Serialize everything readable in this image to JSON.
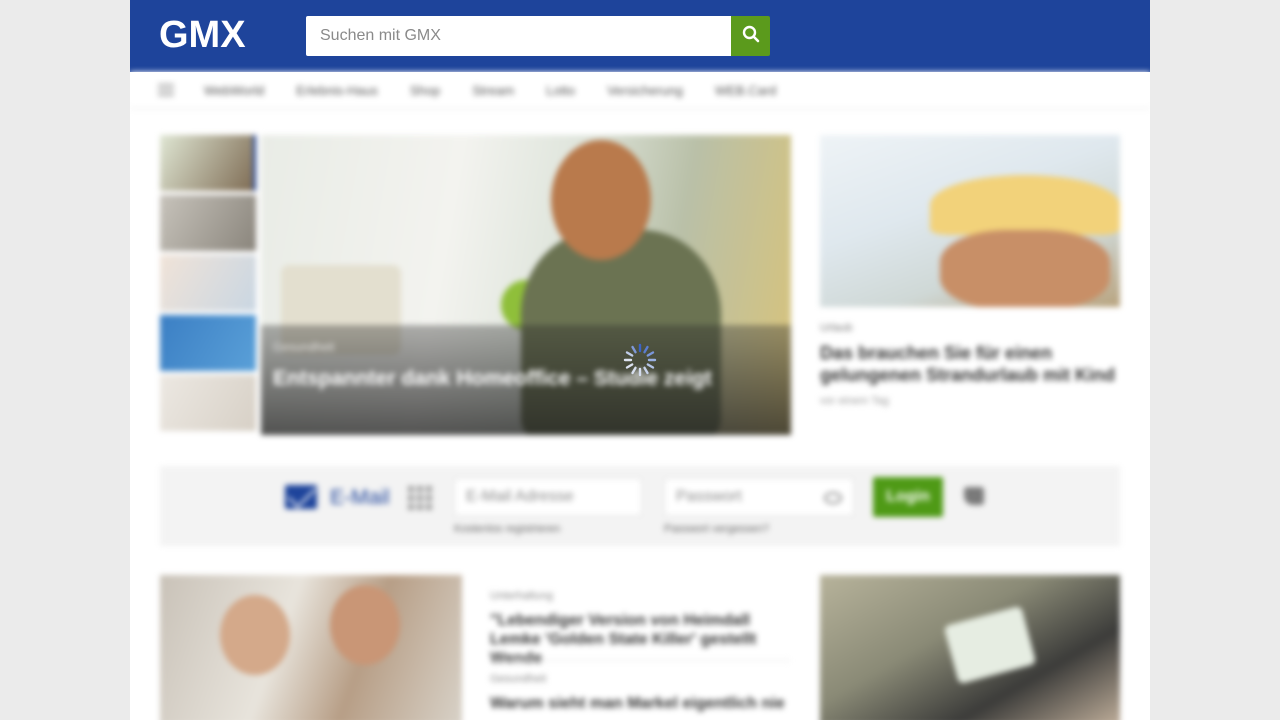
{
  "header": {
    "logo_text": "GMX",
    "search_placeholder": "Suchen mit GMX",
    "search_icon": "search-icon"
  },
  "nav": {
    "items": [
      "WebWorld",
      "Erlebnis-Haus",
      "Shop",
      "Stream",
      "Lotto",
      "Versicherung",
      "WEB.Card"
    ]
  },
  "hero": {
    "kicker": "Gesundheit",
    "title": "Entspannter dank Homeoffice – Studie zeigt"
  },
  "side_article": {
    "kicker": "Urlaub",
    "title": "Das brauchen Sie für einen gelungenen Strandurlaub mit Kind",
    "date": "vor einem Tag"
  },
  "login": {
    "mail_label": "E-Mail",
    "email_placeholder": "E-Mail Adresse",
    "password_placeholder": "Passwort",
    "register_link": "Kostenlos registrieren",
    "forgot_link": "Passwort vergessen?",
    "login_button": "Login"
  },
  "bottom": {
    "kicker1": "Unterhaltung",
    "title1": "\"Lebendiger Version von Heimdall Lemke 'Golden State Killer' gestellt Wende",
    "kicker2": "Gesundheit",
    "title2": "Warum sieht man Markel eigentlich nie"
  },
  "colors": {
    "brand_blue": "#1e449b",
    "accent_green": "#5b9a1c",
    "login_green": "#4f9a16"
  }
}
